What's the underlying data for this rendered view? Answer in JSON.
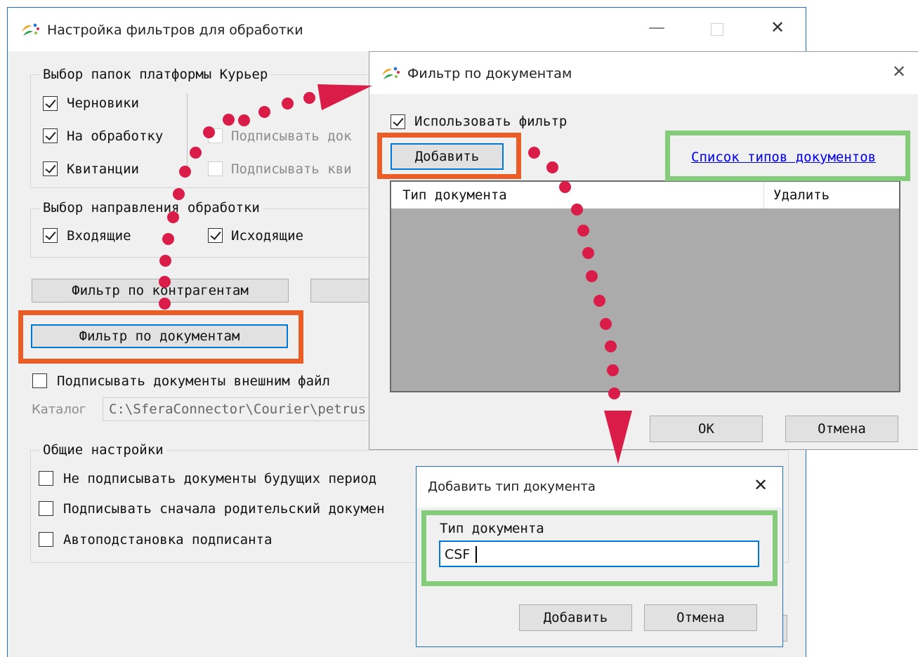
{
  "main_window": {
    "title": "Настройка фильтров для обработки",
    "folders_group": {
      "legend": "Выбор папок платформы Курьер",
      "drafts": {
        "label": "Черновики",
        "checked": true
      },
      "processing": {
        "label": "На обработку",
        "checked": true
      },
      "receipts": {
        "label": "Квитанции",
        "checked": true
      },
      "sign_docs": {
        "label": "Подписывать док",
        "checked": false
      },
      "sign_receipts": {
        "label": "Подписывать кви",
        "checked": false
      }
    },
    "direction_group": {
      "legend": "Выбор направления обработки",
      "incoming": {
        "label": "Входящие",
        "checked": true
      },
      "outgoing": {
        "label": "Исходящие",
        "checked": true
      }
    },
    "filter_contractors_button": "Фильтр по контрагентам",
    "filter_documents_button": "Фильтр по документам",
    "external_sign": {
      "label": "Подписывать документы внешним файл",
      "checked": false
    },
    "catalog": {
      "label": "Каталог",
      "value": "C:\\SferaConnector\\Courier\\petrus"
    },
    "general_group": {
      "legend": "Общие настройки",
      "no_future": {
        "label": "Не подписывать документы будущих период",
        "checked": false
      },
      "parent_first": {
        "label": "Подписывать сначала родительский докумен",
        "checked": false
      },
      "auto_signer": {
        "label": "Автоподстановка подписанта",
        "checked": false
      }
    }
  },
  "doc_filter_dialog": {
    "title": "Фильтр по документам",
    "use_filter": {
      "label": "Использовать фильтр",
      "checked": true
    },
    "add_button": "Добавить",
    "types_link": "Список типов документов",
    "columns": [
      "Тип документа",
      "Удалить"
    ],
    "ok_button": "ОК",
    "cancel_button": "Отмена"
  },
  "add_type_dialog": {
    "title": "Добавить тип документа",
    "field_label": "Тип документа",
    "field_value": "CSF",
    "add_button": "Добавить",
    "cancel_button": "Отмена"
  },
  "icons": {
    "app": "app-logo-icon",
    "minimize": "minimize-icon",
    "maximize": "maximize-icon",
    "close": "close-icon"
  },
  "colors": {
    "highlight_orange": "#ea5d26",
    "highlight_green": "#84cc7a",
    "dots": "#d91c48",
    "focus_blue": "#0078d7",
    "link": "#0000ee"
  }
}
